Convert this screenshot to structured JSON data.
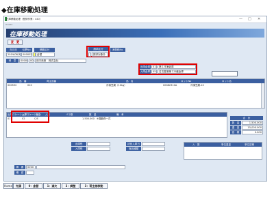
{
  "heading": "◆在庫移動処理",
  "window": {
    "title": "在庫移動処理（登録作業：440）",
    "sub": "Tr9449",
    "controls": [
      "—",
      "□",
      "✕"
    ]
  },
  "banner": "在庫移動処理",
  "mode_button": "変　更",
  "header_fields": {
    "date_label": "年月日",
    "slip_label": "伝票No",
    "move_type_label": "移動区分",
    "request_type_label": "請求区分",
    "tax_label": "消費税No.",
    "date_value": "2019/08/31",
    "slip_value": "000002",
    "move_type_value": "倉替",
    "request_code": "1",
    "request_name": "請求対象外"
  },
  "customer": {
    "label": "得　意",
    "code": "000005",
    "branch": "000",
    "name": "田中商事　株式会社"
  },
  "warehouses": {
    "out_label": "出庫倉庫",
    "out_code": "01",
    "out_name": "第１冷凍倉庫",
    "in_label": "入庫倉庫",
    "in_code": "05",
    "in_name": "名古屋港第２冷蔵倉庫"
  },
  "item_table": {
    "headers": [
      "品　番",
      "荷主品番",
      "品　名",
      "ロットNo",
      "ロット名"
    ],
    "rows": [
      [
        "000532",
        "010",
        "",
        "冷凍豆腐（10kg）",
        "00082310A",
        "冷凍豆腐-10"
      ]
    ]
  },
  "location_table": {
    "headers": [
      "出庫ロケーション",
      "入庫ロケーション",
      "単位",
      "入数",
      "バラ数",
      "数　量",
      "備　考"
    ],
    "row": {
      "out_loc": "01",
      "in_loc": "02",
      "unit": "C/S",
      "qty": "1,500.000",
      "note": "※運動費一式"
    }
  },
  "totals": {
    "header": "合　計",
    "rows": [
      {
        "label": "数　量",
        "value": "1,500.000"
      },
      {
        "label": "重　量",
        "value": "15,000.000"
      },
      {
        "label": "容　積",
        "value": "0.000"
      }
    ]
  },
  "stock": {
    "out_label": "出庫残",
    "in_label": "入庫残",
    "first_date_label": "初回入庫日",
    "product_type_label": "商品種類"
  },
  "mini_table": {
    "headers": [
      "入　数",
      "単位重量",
      "単位容積"
    ]
  },
  "summary": {
    "label": "摘　要",
    "code": "0000"
  },
  "confirm": {
    "label": "確　認"
  },
  "bottom_tabs": [
    {
      "key": "Home",
      "label": "先頭"
    },
    {
      "key": "0",
      "label": "0：倉替"
    },
    {
      "key": "1",
      "label": "1：減欠"
    },
    {
      "key": "2",
      "label": "2：調整"
    },
    {
      "key": "3",
      "label": "3：荷主間移動"
    }
  ],
  "colors": {
    "accent": "#3b5fa0",
    "highlight": "#e00000",
    "window_bg": "#dfe8f3"
  }
}
